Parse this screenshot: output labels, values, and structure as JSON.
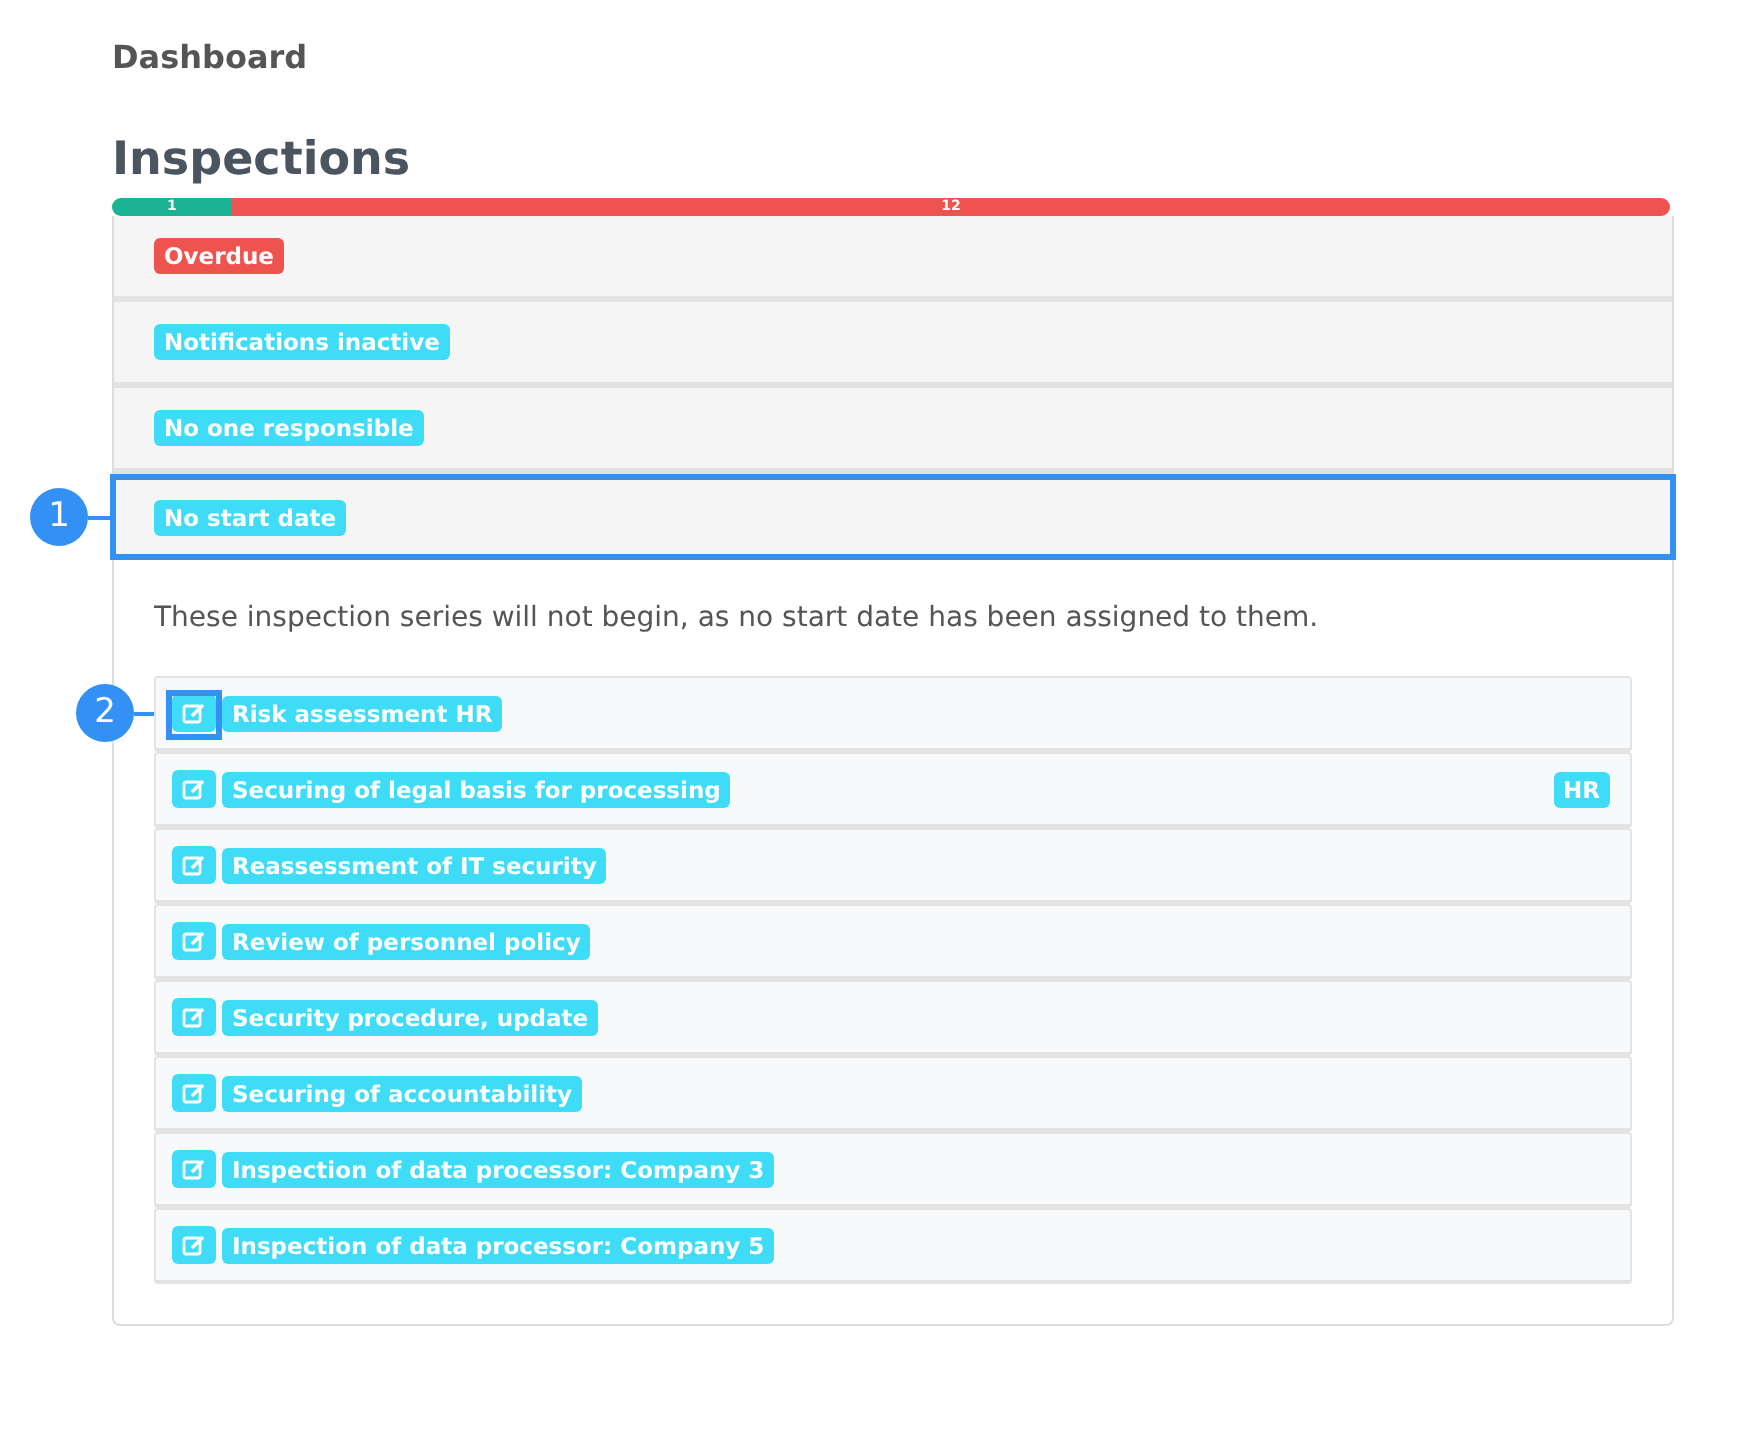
{
  "breadcrumb": "Dashboard",
  "title": "Inspections",
  "progress": [
    {
      "label": "1",
      "level": 0.077,
      "color": "#1ab394"
    },
    {
      "label": "12",
      "level": 0.923,
      "color": "#ef5350"
    }
  ],
  "panels": [
    {
      "badge": "Overdue",
      "color": "#ef5350",
      "expanded": false
    },
    {
      "badge": "Notifications inactive",
      "color": "#3fdcf7",
      "expanded": false
    },
    {
      "badge": "No one responsible",
      "color": "#3fdcf7",
      "expanded": false
    },
    {
      "badge": "No start date",
      "color": "#3fdcf7",
      "expanded": true,
      "callout": "1",
      "description": "These inspection series will not begin, as no start date has been assigned to them.",
      "items": [
        {
          "label": "Risk assessment HR",
          "callout": "2"
        },
        {
          "label": "Securing of legal basis for processing",
          "tag": "HR"
        },
        {
          "label": "Reassessment of IT security"
        },
        {
          "label": "Review of personnel policy"
        },
        {
          "label": "Security procedure, update"
        },
        {
          "label": "Securing of accountability"
        },
        {
          "label": "Inspection of data processor: Company 3"
        },
        {
          "label": "Inspection of data processor: Company 5"
        }
      ]
    }
  ]
}
